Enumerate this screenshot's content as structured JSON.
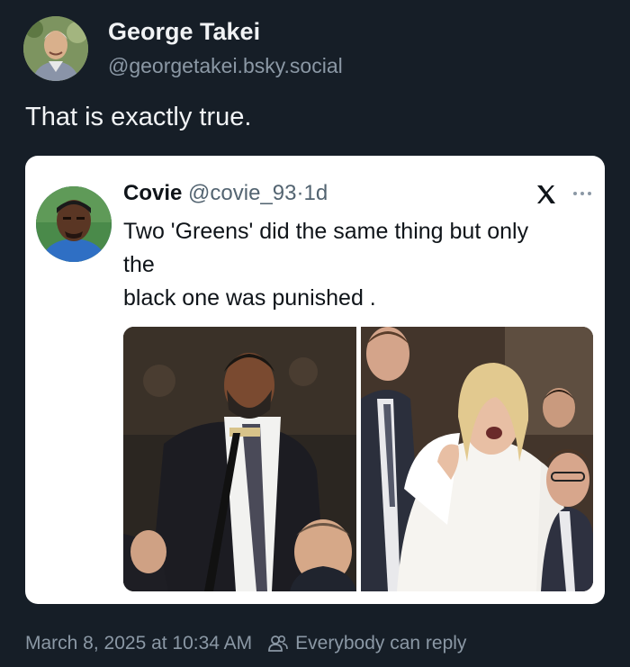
{
  "post": {
    "author_name": "George Takei",
    "author_handle": "@georgetakei.bsky.social",
    "text": "That is exactly true.",
    "timestamp": "March 8, 2025 at 10:34 AM",
    "reply_setting": "Everybody can reply"
  },
  "quote": {
    "name": "Covie",
    "handle": "@covie_93",
    "separator": "·",
    "age": "1d",
    "lines": [
      "Two 'Greens' did the same thing but only",
      "the",
      "black one was punished ."
    ],
    "platform_icon": "x-logo-icon",
    "more_icon": "more-icon"
  },
  "icons": {
    "reply_setting": "people-icon"
  },
  "colors": {
    "background": "#161e27",
    "text_primary": "#f1f3f5",
    "text_secondary": "#8b98a5",
    "card": "#ffffff"
  }
}
